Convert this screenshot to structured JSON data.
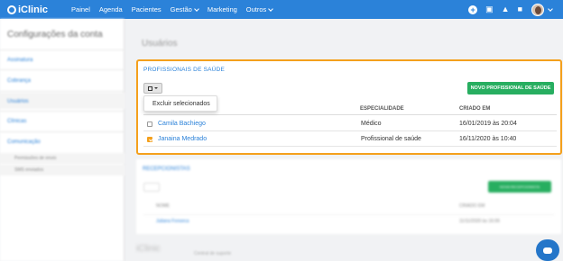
{
  "brand": {
    "name": "iClinic"
  },
  "nav": {
    "items": [
      {
        "label": "Painel"
      },
      {
        "label": "Agenda"
      },
      {
        "label": "Pacientes"
      },
      {
        "label": "Gestão",
        "dropdown": true
      },
      {
        "label": "Marketing"
      },
      {
        "label": "Outros",
        "dropdown": true
      }
    ],
    "icons": [
      "plus-circle-icon",
      "gift-icon",
      "bell-icon",
      "chat-icon",
      "avatar"
    ]
  },
  "sidebar": {
    "title": "Configurações da conta",
    "items": [
      {
        "label": "Assinatura"
      },
      {
        "label": "Cobrança"
      },
      {
        "label": "Usuários",
        "selected": true
      },
      {
        "label": "Clínicas"
      },
      {
        "label": "Comunicação"
      }
    ],
    "subitems": [
      {
        "label": "Permissões de envio"
      },
      {
        "label": "SMS enviados"
      }
    ]
  },
  "main": {
    "title": "Usuários",
    "professionals": {
      "title": "PROFISSIONAIS DE SAÚDE",
      "new_button": "NOVO PROFISSIONAL DE SAÚDE",
      "bulk_menu_item": "Excluir selecionados",
      "columns": {
        "specialty": "ESPECIALIDADE",
        "created": "CRIADO EM"
      },
      "rows": [
        {
          "name": "Camila Bachiego",
          "specialty": "Médico",
          "created": "16/01/2019 às 20:04",
          "checked": false
        },
        {
          "name": "Janaina Medrado",
          "specialty": "Profissional de saúde",
          "created": "16/11/2020 às 10:40",
          "checked": true
        }
      ]
    },
    "receptionists": {
      "title": "RECEPCIONISTAS",
      "new_button": "NOVA RECEPCIONISTA",
      "columns": {
        "name": "NOME",
        "created": "CRIADO EM"
      },
      "rows": [
        {
          "name": "Juliana Fonseca",
          "created": "11/11/2020 às 16:06"
        }
      ]
    },
    "footer": {
      "logo": "iClinic",
      "link": "Central de suporte"
    }
  },
  "colors": {
    "primary": "#2b82d9",
    "accent": "#f4a01c",
    "success": "#27ae60"
  }
}
